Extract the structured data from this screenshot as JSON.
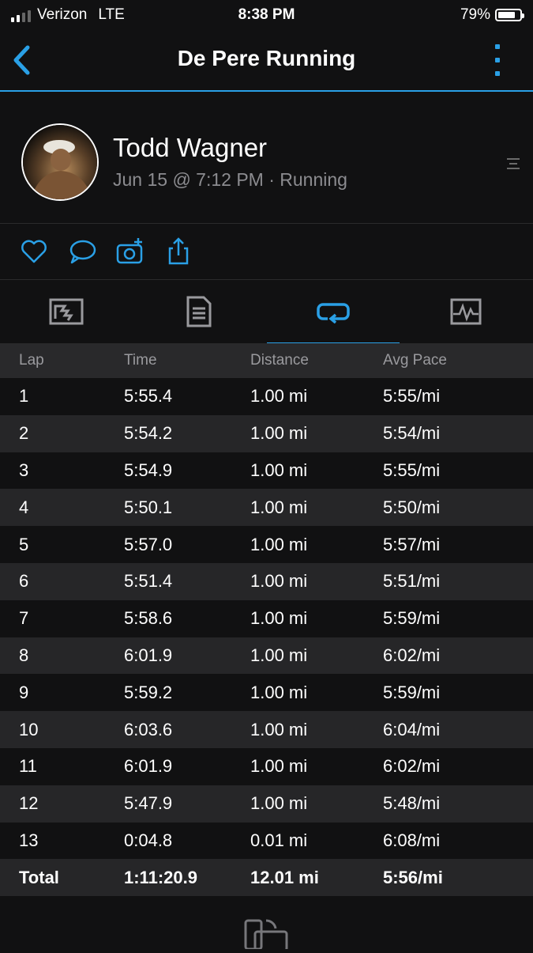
{
  "status_bar": {
    "carrier": "Verizon",
    "network": "LTE",
    "time": "8:38 PM",
    "battery": "79%",
    "battery_level": 0.79
  },
  "nav": {
    "title": "De Pere Running",
    "back_icon": "chevron-left-icon",
    "more_icon": "more-vertical-icon"
  },
  "activity": {
    "user_name": "Todd Wagner",
    "meta": "Jun 15 @ 7:12 PM · Running"
  },
  "actions": [
    "heart-icon",
    "comment-icon",
    "add-photo-icon",
    "share-icon"
  ],
  "tabs": [
    {
      "icon": "map-icon",
      "active": false
    },
    {
      "icon": "details-icon",
      "active": false
    },
    {
      "icon": "laps-icon",
      "active": true
    },
    {
      "icon": "chart-icon",
      "active": false
    }
  ],
  "laps": {
    "headers": [
      "Lap",
      "Time",
      "Distance",
      "Avg Pace"
    ],
    "rows": [
      [
        "1",
        "5:55.4",
        "1.00 mi",
        "5:55/mi"
      ],
      [
        "2",
        "5:54.2",
        "1.00 mi",
        "5:54/mi"
      ],
      [
        "3",
        "5:54.9",
        "1.00 mi",
        "5:55/mi"
      ],
      [
        "4",
        "5:50.1",
        "1.00 mi",
        "5:50/mi"
      ],
      [
        "5",
        "5:57.0",
        "1.00 mi",
        "5:57/mi"
      ],
      [
        "6",
        "5:51.4",
        "1.00 mi",
        "5:51/mi"
      ],
      [
        "7",
        "5:58.6",
        "1.00 mi",
        "5:59/mi"
      ],
      [
        "8",
        "6:01.9",
        "1.00 mi",
        "6:02/mi"
      ],
      [
        "9",
        "5:59.2",
        "1.00 mi",
        "5:59/mi"
      ],
      [
        "10",
        "6:03.6",
        "1.00 mi",
        "6:04/mi"
      ],
      [
        "11",
        "6:01.9",
        "1.00 mi",
        "6:02/mi"
      ],
      [
        "12",
        "5:47.9",
        "1.00 mi",
        "5:48/mi"
      ],
      [
        "13",
        "0:04.8",
        "0.01 mi",
        "6:08/mi"
      ]
    ],
    "total": [
      "Total",
      "1:11:20.9",
      "12.01 mi",
      "5:56/mi"
    ]
  },
  "colors": {
    "accent": "#2aa0e6",
    "background": "#111112",
    "row_alt": "#262628",
    "muted_text": "#8c8c90"
  }
}
